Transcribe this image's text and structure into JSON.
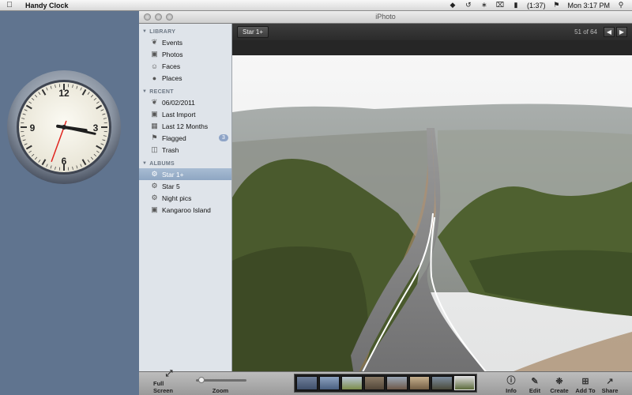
{
  "menubar": {
    "app_name": "Handy Clock",
    "battery": "(1:37)",
    "datetime": "Mon 3:17 PM"
  },
  "window": {
    "title": "iPhoto"
  },
  "sidebar": {
    "library_label": "LIBRARY",
    "library_items": [
      {
        "label": "Events",
        "icon": "events-icon"
      },
      {
        "label": "Photos",
        "icon": "photos-icon"
      },
      {
        "label": "Faces",
        "icon": "faces-icon"
      },
      {
        "label": "Places",
        "icon": "places-icon"
      }
    ],
    "recent_label": "RECENT",
    "recent_items": [
      {
        "label": "06/02/2011",
        "icon": "event-icon"
      },
      {
        "label": "Last Import",
        "icon": "import-icon"
      },
      {
        "label": "Last 12 Months",
        "icon": "calendar-icon"
      },
      {
        "label": "Flagged",
        "icon": "flag-icon",
        "badge": "3"
      },
      {
        "label": "Trash",
        "icon": "trash-icon"
      }
    ],
    "albums_label": "ALBUMS",
    "album_items": [
      {
        "label": "Star 1+",
        "icon": "smart-album-icon",
        "selected": true
      },
      {
        "label": "Star 5",
        "icon": "smart-album-icon"
      },
      {
        "label": "Night pics",
        "icon": "smart-album-icon"
      },
      {
        "label": "Kangaroo Island",
        "icon": "album-icon"
      }
    ]
  },
  "viewer": {
    "album_button": "Star 1+",
    "counter": "51 of 64"
  },
  "toolbar": {
    "full_screen": "Full Screen",
    "zoom": "Zoom",
    "zoom_level": 0.05,
    "info": "Info",
    "edit": "Edit",
    "create": "Create",
    "add_to": "Add To",
    "share": "Share"
  },
  "clock": {
    "hour": 3,
    "minute": 17,
    "numerals": [
      "12",
      "3",
      "6",
      "9"
    ]
  },
  "colors": {
    "desktop": "#60748f",
    "selection": "#8ea6c2",
    "second_hand": "#e0251f"
  }
}
